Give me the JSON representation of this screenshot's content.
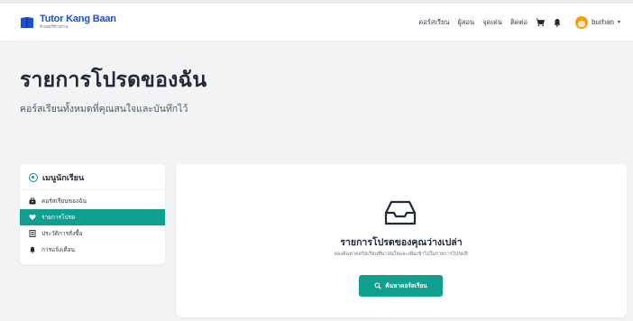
{
  "brand": {
    "title": "Tutor Kang Baan",
    "subtitle": "ติวเตอร์ข้างบ้าน",
    "color": "#1d4ed8"
  },
  "nav": {
    "links": [
      "คอร์สเรียน",
      "ผู้สอน",
      "จุดเด่น",
      "ติดต่อ"
    ],
    "cart_icon": "cart-icon",
    "bell_icon": "bell-icon",
    "user_name": "burhan",
    "caret": "▾"
  },
  "hero": {
    "title": "รายการโปรดของฉัน",
    "subtitle": "คอร์สเรียนทั้งหมดที่คุณสนใจและบันทึกไว้"
  },
  "sidebar": {
    "title": "เมนูนักเรียน",
    "items": [
      {
        "label": "คอร์สเรียนของฉัน",
        "icon": "toolbox-icon",
        "active": false
      },
      {
        "label": "รายการโปรด",
        "icon": "heart-icon",
        "active": true
      },
      {
        "label": "ประวัติการสั่งซื้อ",
        "icon": "receipt-icon",
        "active": false
      },
      {
        "label": "การแจ้งเตือน",
        "icon": "bell-icon",
        "active": false
      }
    ]
  },
  "empty_state": {
    "icon": "inbox-icon",
    "title": "รายการโปรดของคุณว่างเปล่า",
    "subtitle": "ลองค้นหาคอร์สเรียนที่น่าสนใจและเพิ่มเข้าไปในรายการโปรดสิ!",
    "button_label": "ค้นหาคอร์สเรียน"
  },
  "colors": {
    "accent": "#0f9f8e",
    "brand": "#1d4ed8",
    "background": "#f2f3f5"
  }
}
